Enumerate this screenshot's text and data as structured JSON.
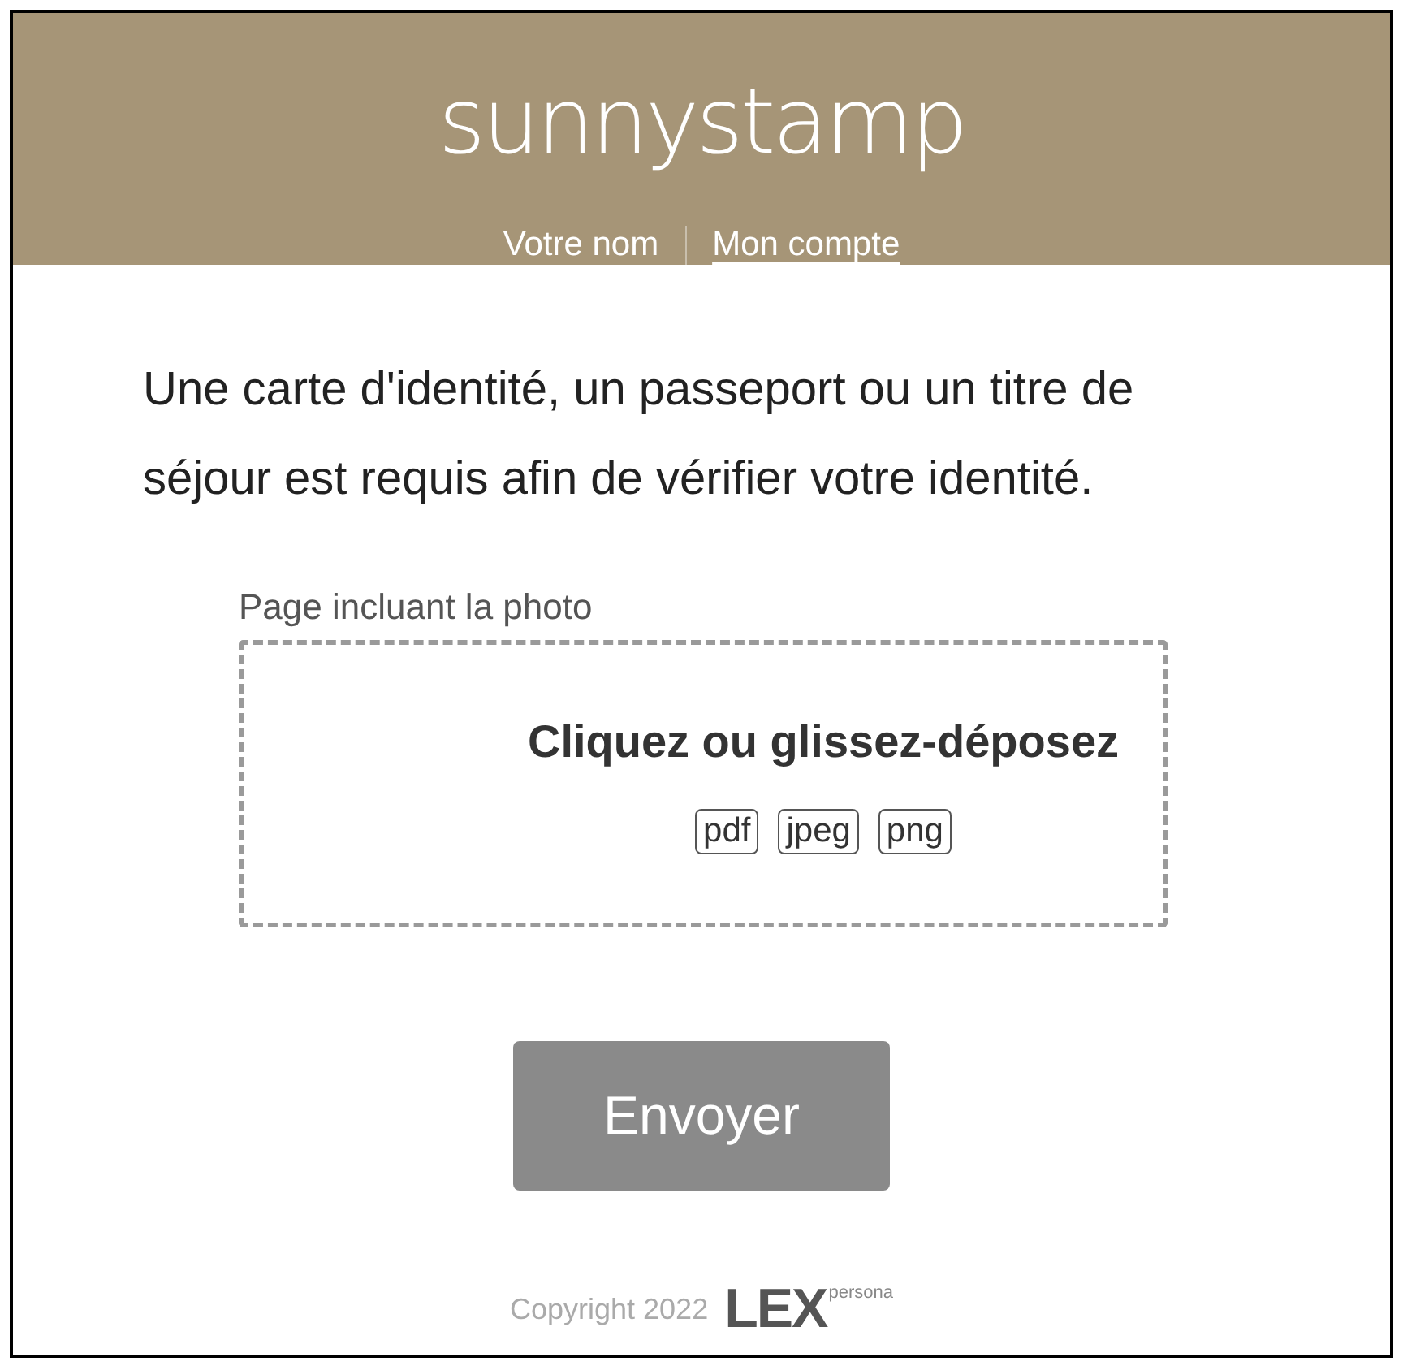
{
  "header": {
    "logo": "sunnystamp",
    "nav": [
      {
        "label": "Votre nom",
        "kind": "text"
      },
      {
        "label": "Mon compte",
        "kind": "link"
      }
    ]
  },
  "intro": "Une carte d'identité, un passeport ou un titre de séjour est requis afin de vérifier votre identité.",
  "upload": {
    "label": "Page incluant la photo",
    "prompt": "Cliquez ou glissez-déposez",
    "formats": [
      "pdf",
      "jpeg",
      "png"
    ]
  },
  "submit_button": {
    "label": "Envoyer",
    "disabled": true
  },
  "footer": {
    "copyright": "Copyright 2022",
    "brand": "LEX",
    "brand_sup": "persona"
  }
}
